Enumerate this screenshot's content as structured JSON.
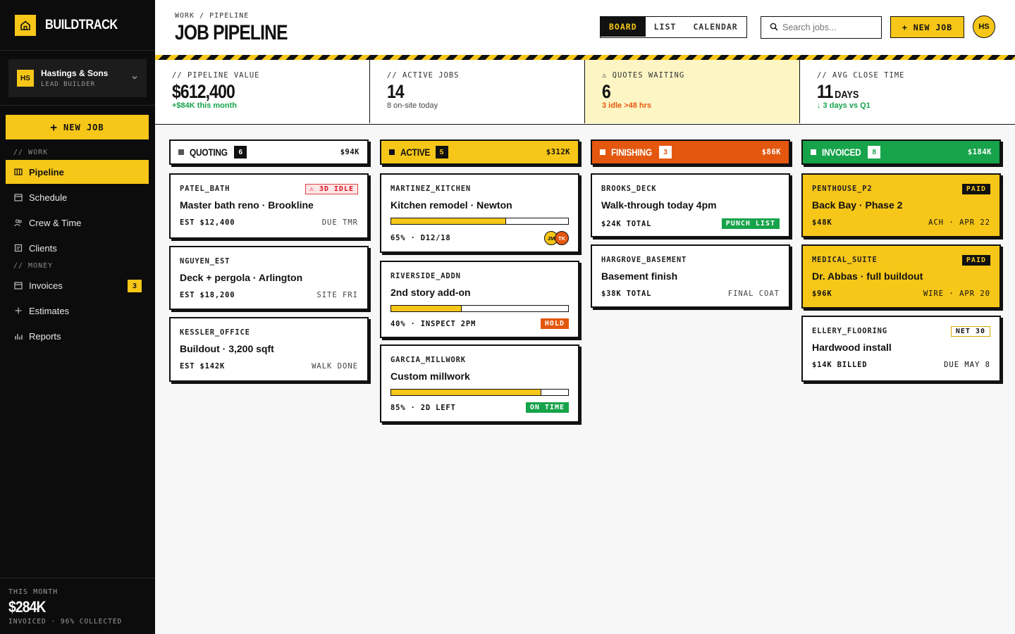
{
  "app": {
    "name": "BUILDTRACK"
  },
  "org": {
    "initials": "HS",
    "name": "Hastings & Sons",
    "role": "LEAD BUILDER"
  },
  "sidebar": {
    "new_job_label": "NEW JOB",
    "section_work": "// WORK",
    "section_money": "// MONEY",
    "items": [
      {
        "label": "Pipeline",
        "icon": "columns-icon",
        "active": true
      },
      {
        "label": "Schedule",
        "icon": "calendar-icon"
      },
      {
        "label": "Crew & Time",
        "icon": "users-icon"
      },
      {
        "label": "Clients",
        "icon": "clipboard-icon"
      },
      {
        "label": "Invoices",
        "icon": "invoice-icon",
        "badge": "3"
      },
      {
        "label": "Estimates",
        "icon": "plus-icon"
      },
      {
        "label": "Reports",
        "icon": "bar-chart-icon"
      }
    ],
    "footer": {
      "label": "THIS MONTH",
      "value": "$284K",
      "sub": "INVOICED · 96% COLLECTED"
    }
  },
  "header": {
    "breadcrumb": "WORK / PIPELINE",
    "title": "JOB PIPELINE",
    "views": [
      "BOARD",
      "LIST",
      "CALENDAR"
    ],
    "active_view": "BOARD",
    "search_placeholder": "Search jobs...",
    "new_job_label": "+ NEW JOB",
    "user_initials": "HS"
  },
  "stats": [
    {
      "label": "// PIPELINE VALUE",
      "value": "$612,400",
      "sub": "+$84K this month"
    },
    {
      "label": "// ACTIVE JOBS",
      "value": "14",
      "sub": "8 on-site today"
    },
    {
      "label": "⚠ QUOTES WAITING",
      "value": "6",
      "sub": "3 idle >48 hrs"
    },
    {
      "label": "// AVG CLOSE TIME",
      "value": "11",
      "unit": "DAYS",
      "sub": "↓ 3 days vs Q1"
    }
  ],
  "columns": [
    {
      "name": "QUOTING",
      "count": "6",
      "total": "$94K",
      "cards": [
        {
          "code": "PATEL_BATH",
          "tag": "⚠ 3D IDLE",
          "title": "Master bath reno · Brookline",
          "left": "EST $12,400",
          "right": "DUE TMR"
        },
        {
          "code": "NGUYEN_EST",
          "title": "Deck + pergola · Arlington",
          "left": "EST $18,200",
          "right": "SITE FRI"
        },
        {
          "code": "KESSLER_OFFICE",
          "title": "Buildout · 3,200 sqft",
          "left": "EST $142K",
          "right": "WALK DONE"
        }
      ]
    },
    {
      "name": "ACTIVE",
      "count": "5",
      "total": "$312K",
      "cards": [
        {
          "code": "MARTINEZ_KITCHEN",
          "title": "Kitchen remodel · Newton",
          "progress": 65,
          "left": "65% · D12/18",
          "avatars": [
            "JM",
            "TK"
          ]
        },
        {
          "code": "RIVERSIDE_ADDN",
          "title": "2nd story add-on",
          "progress": 40,
          "left": "40% · INSPECT 2PM",
          "tag": "HOLD"
        },
        {
          "code": "GARCIA_MILLWORK",
          "title": "Custom millwork",
          "progress": 85,
          "left": "85% · 2D LEFT",
          "tag": "ON TIME"
        }
      ]
    },
    {
      "name": "FINISHING",
      "count": "3",
      "total": "$86K",
      "cards": [
        {
          "code": "BROOKS_DECK",
          "title": "Walk-through today 4pm",
          "left": "$24K TOTAL",
          "tag": "PUNCH LIST"
        },
        {
          "code": "HARGROVE_BASEMENT",
          "title": "Basement finish",
          "left": "$38K TOTAL",
          "right": "FINAL COAT"
        }
      ]
    },
    {
      "name": "INVOICED",
      "count": "8",
      "total": "$184K",
      "cards": [
        {
          "code": "PENTHOUSE_P2",
          "tag": "PAID",
          "title": "Back Bay · Phase 2",
          "left": "$48K",
          "right": "ACH · APR 22"
        },
        {
          "code": "MEDICAL_SUITE",
          "tag": "PAID",
          "title": "Dr. Abbas · full buildout",
          "left": "$96K",
          "right": "WIRE · APR 20"
        },
        {
          "code": "ELLERY_FLOORING",
          "tag": "NET 30",
          "title": "Hardwood install",
          "left": "$14K BILLED",
          "right": "DUE MAY 8"
        }
      ]
    }
  ],
  "colors": {
    "accent": "#f6c618",
    "orange": "#e4570f",
    "green": "#16a34a",
    "dark": "#0c0c0c"
  }
}
